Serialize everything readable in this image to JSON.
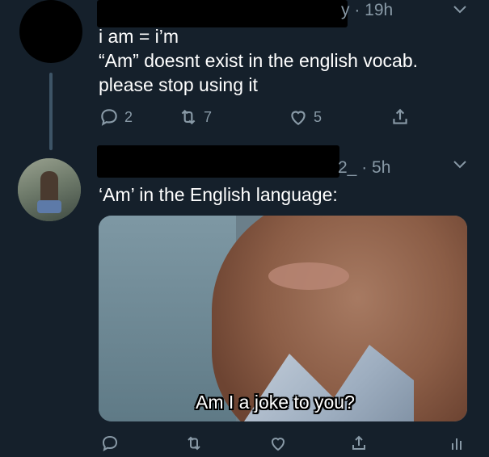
{
  "tweet1": {
    "handle_tail": "y",
    "time": "· 19h",
    "text_lines": [
      "i am = i’m",
      "“Am” doesnt exist in the english vocab.",
      "please stop using it"
    ],
    "counts": {
      "replies": "2",
      "retweets": "7",
      "likes": "5"
    }
  },
  "tweet2": {
    "handle_tail": "2_",
    "time": "· 5h",
    "text": "‘Am’ in the English language:",
    "image_caption": "Am I a joke to you?"
  },
  "icons": {
    "reply": "reply-icon",
    "retweet": "retweet-icon",
    "like": "heart-icon",
    "share": "share-icon",
    "stats": "stats-icon",
    "more": "chevron-down-icon"
  },
  "colors": {
    "background": "#15202b",
    "secondary_text": "#8899a6",
    "thread_line": "#3d5466"
  }
}
